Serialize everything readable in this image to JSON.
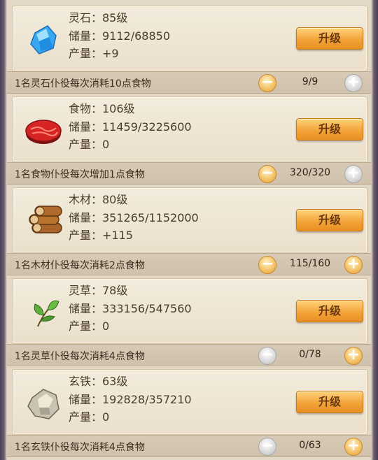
{
  "upgrade_label": "升级",
  "resources": [
    {
      "id": "lingshi",
      "icon": "blue-crystal-icon",
      "line1": "灵石：85级",
      "line2": "储量：9112/68850",
      "line3": "产量：+9",
      "desc": "1名灵石仆役每次消耗10点食物",
      "count": "9/9",
      "minus_enabled": true,
      "plus_enabled": false
    },
    {
      "id": "food",
      "icon": "meat-icon",
      "line1": "食物：106级",
      "line2": "储量：11459/3225600",
      "line3": "产量：0",
      "desc": "1名食物仆役每次增加1点食物",
      "count": "320/320",
      "minus_enabled": true,
      "plus_enabled": false
    },
    {
      "id": "wood",
      "icon": "wood-logs-icon",
      "line1": "木材：80级",
      "line2": "储量：351265/1152000",
      "line3": "产量：+115",
      "desc": "1名木材仆役每次消耗2点食物",
      "count": "115/160",
      "minus_enabled": true,
      "plus_enabled": true
    },
    {
      "id": "herb",
      "icon": "herb-leaf-icon",
      "line1": "灵草：78级",
      "line2": "储量：333156/547560",
      "line3": "产量：0",
      "desc": "1名灵草仆役每次消耗4点食物",
      "count": "0/78",
      "minus_enabled": false,
      "plus_enabled": true
    },
    {
      "id": "iron",
      "icon": "iron-ore-icon",
      "line1": "玄铁：63级",
      "line2": "储量：192828/357210",
      "line3": "产量：0",
      "desc": "1名玄铁仆役每次消耗4点食物",
      "count": "0/63",
      "minus_enabled": false,
      "plus_enabled": true
    }
  ]
}
